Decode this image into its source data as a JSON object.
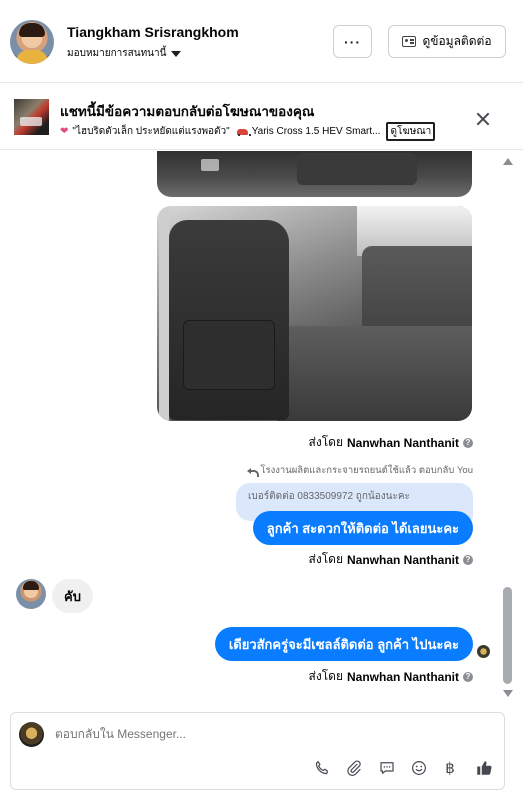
{
  "header": {
    "contact_name": "Tiangkham Srisrangkhom",
    "assign_label": "มอบหมายการสนทนานี้",
    "more_label": "···",
    "info_button_label": "ดูข้อมูลติดต่อ"
  },
  "ad_banner": {
    "title": "แชทนี้มีข้อความตอบกลับต่อโฆษณาของคุณ",
    "subtitle": "\"ไฮบริดตัวเล็ก ประหยัดแต่แรงพอตัว\"",
    "subtitle_car": "Yaris Cross 1.5 HEV Smart...",
    "view_ad_label": "ดูโฆษณา"
  },
  "messages": {
    "sent_prefix": "ส่งโดย",
    "sender_name": "Nanwhan Nanthanit",
    "reply_ref": "โรงงานผลิตและกระจายรถยนต์ใช้แล้ว ตอบกลับ You",
    "quoted_text": "เบอร์ติดต่อ 0833509972 ถูกน้องนะคะ",
    "out_message_1": "ลูกค้า  สะดวกให้ติดต่อ ได้เลยนะคะ",
    "in_message_1": "คับ",
    "out_message_2": "เดียวสักครู่จะมีเซลล์ติดต่อ ลูกค้า ไปนะคะ"
  },
  "composer": {
    "placeholder": "ตอบกลับใน Messenger...",
    "tools": [
      "phone-icon",
      "paperclip-icon",
      "chat-icon",
      "emoji-icon",
      "baht-icon",
      "thumbs-up-icon"
    ],
    "baht_symbol": "฿"
  },
  "colors": {
    "outgoing_bubble": "#0a7cff",
    "incoming_bubble": "#f0f0f0",
    "quote_bubble": "#dbe7fb",
    "muted_text": "#65676b"
  }
}
